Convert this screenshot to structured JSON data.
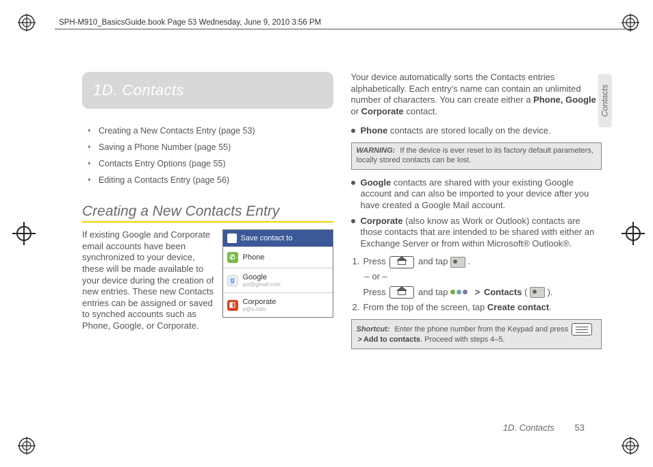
{
  "header": {
    "line": "SPH-M910_BasicsGuide.book  Page 53  Wednesday, June 9, 2010  3:56 PM"
  },
  "chapter": {
    "title": "1D. Contacts"
  },
  "toc": {
    "items": [
      "Creating a New Contacts Entry (page 53)",
      "Saving a Phone Number (page 55)",
      "Contacts Entry Options (page 55)",
      "Editing a Contacts Entry (page 56)"
    ]
  },
  "section_a": {
    "heading": "Creating a New Contacts Entry",
    "body": "If existing Google and Corporate email accounts have been synchronized to your device, these will be made available to your device during the creation of new entries. These new Contacts entries can be assigned or saved to synched accounts such as Phone, Google, or Corporate."
  },
  "popup": {
    "title": "Save contact to",
    "rows": [
      {
        "label": "Phone",
        "sub": ""
      },
      {
        "label": "Google",
        "sub": "pol@gmail.com"
      },
      {
        "label": "Corporate",
        "sub": "p@s.com"
      }
    ]
  },
  "right": {
    "lead": "Your device automatically sorts the Contacts entries alphabetically. Each entry's name can contain an unlimited number of characters. You can create either a ",
    "lead_bold_1": "Phone, Google",
    "lead_mid_1": " or ",
    "lead_bold_2": "Corporate",
    "lead_end": " contact.",
    "b1_bold": "Phone",
    "b1_rest": " contacts are stored locally on the device.",
    "warning_label": "WARNING:",
    "warning_text": " If the device is ever reset to its factory default parameters, locally stored contacts can be lost.",
    "b2_bold": "Google",
    "b2_rest": " contacts are shared with your existing Google account and can also be imported to your device after you have created a Google Mail account.",
    "b3_bold": "Corporate",
    "b3_rest": " (also know as Work or Outlook) contacts are those contacts that are intended to be shared with either an Exchange Server or from within Microsoft® Outlook®.",
    "step1a": "Press ",
    "step1b": " and tap ",
    "step1c": " .",
    "or_line": "– or –",
    "step1d": "Press ",
    "step1e": " and tap ",
    "step1f_bold": "Contacts",
    "step1g": " ( ",
    "step1h": " ).",
    "step2a": "From the top of the screen, tap ",
    "step2b_bold": "Create contact",
    "step2c": ".",
    "shortcut_label": "Shortcut:",
    "shortcut_a": " Enter the phone number from the Keypad and press ",
    "shortcut_b_bold": "Add to contacts",
    "shortcut_c": ". Proceed with steps 4–5."
  },
  "side_tab": "Contacts",
  "footer": {
    "title": "1D. Contacts",
    "page": "53"
  }
}
